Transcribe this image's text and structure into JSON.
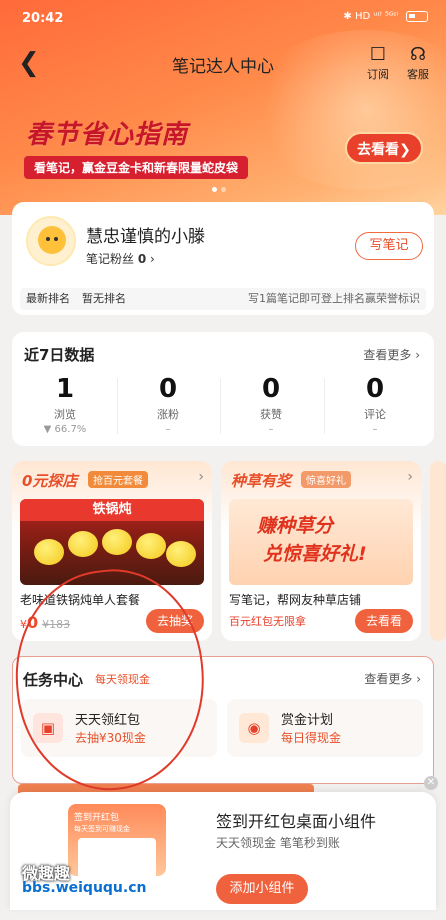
{
  "status_bar": {
    "time": "20:42",
    "icons_text": "✱ HD ᵘᶦˡ ⁵ᴳᶦˡ"
  },
  "nav": {
    "title": "笔记达人中心",
    "subscribe_label": "订阅",
    "service_label": "客服"
  },
  "banner": {
    "title": "春节省心指南",
    "subtitle": "看笔记，赢金豆金卡和新春限量蛇皮袋",
    "button": "去看看"
  },
  "profile": {
    "name": "慧忠谨慎的小滕",
    "fans_label": "笔记粉丝",
    "fans_count": "0",
    "write_button": "写笔记",
    "rank_label": "最新排名",
    "rank_value": "暂无排名",
    "rank_hint": "写1篇笔记即可登上排名赢荣誉标识"
  },
  "stats": {
    "title": "近7日数据",
    "more": "查看更多",
    "items": [
      {
        "value": "1",
        "label": "浏览",
        "sub": "▼ 66.7%"
      },
      {
        "value": "0",
        "label": "涨粉",
        "sub": "–"
      },
      {
        "value": "0",
        "label": "获赞",
        "sub": "–"
      },
      {
        "value": "0",
        "label": "评论",
        "sub": "–"
      }
    ]
  },
  "promos": [
    {
      "title": "0元探店",
      "tag": "抢百元套餐",
      "image_text": "铁锅炖",
      "desc": "老味道铁锅炖单人套餐",
      "price": "0",
      "currency": "¥",
      "orig": "¥183",
      "button": "去抽奖"
    },
    {
      "title": "种草有奖",
      "tag": "惊喜好礼",
      "image_text1": "赚种草分",
      "image_text2": "兑惊喜好礼!",
      "desc": "写笔记，帮网友种草店铺",
      "red": "百元红包无限拿",
      "button": "去看看"
    }
  ],
  "tasks": {
    "title": "任务中心",
    "tag": "每天领现金",
    "more": "查看更多",
    "items": [
      {
        "name": "天天领红包",
        "sub": "去抽¥30现金"
      },
      {
        "name": "赏金计划",
        "sub": "每日得现金"
      }
    ]
  },
  "popup": {
    "title": "签到开红包桌面小组件",
    "subtitle": "天天领现金 笔笔秒到账",
    "button": "添加小组件",
    "thumb_title": "签到开红包",
    "thumb_sub": "每天签到可赚现金"
  },
  "watermark": {
    "line1": "微趣趣",
    "line2": "bbs.weiququ.cn"
  },
  "colors": {
    "accent": "#f0623e",
    "annotation": "#e03a2a"
  }
}
